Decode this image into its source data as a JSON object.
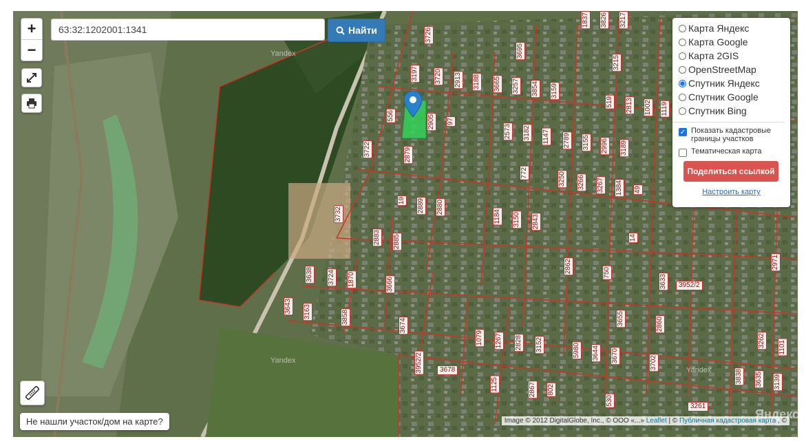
{
  "search": {
    "value": "63:32:1202001:1341",
    "button_label": "Найти"
  },
  "controls": {
    "zoom_in": "+",
    "zoom_out": "−"
  },
  "layers": [
    {
      "label": "Карта Яндекс",
      "selected": false
    },
    {
      "label": "Карта Google",
      "selected": false
    },
    {
      "label": "Карта 2GIS",
      "selected": false
    },
    {
      "label": "OpenStreetMap",
      "selected": false
    },
    {
      "label": "Спутник Яндекс",
      "selected": true
    },
    {
      "label": "Спутник Google",
      "selected": false
    },
    {
      "label": "Спутник Bing",
      "selected": false
    }
  ],
  "options": {
    "cadastral": {
      "label": "Показать кадастровые границы участков",
      "checked": true
    },
    "thematic": {
      "label": "Тематическая карта",
      "checked": false
    }
  },
  "share_label": "Поделиться ссылкой",
  "config_label": "Настроить карту",
  "not_found_label": "Не нашли участок/дом на карте?",
  "attribution": {
    "imagery": "Image © 2012 DigitalGlobe, Inc., © OOO «...»",
    "leaflet": "Leaflet",
    "sep1": "| ©",
    "pkk": "Публичная кадастровая карта",
    "sep2": ", ©"
  },
  "watermarks": [
    "Yandex",
    "Yandex",
    "Yandex",
    "Яндекс"
  ],
  "parcels": [
    "3726",
    "3695",
    "3197",
    "3720",
    "2913",
    "3188",
    "3665",
    "3257",
    "3854",
    "3159",
    "3215",
    "519",
    "2813",
    "1002",
    "1119",
    "556",
    "2905",
    "97",
    "2573",
    "3182",
    "1147",
    "2789",
    "3155",
    "2996",
    "3189",
    "3722",
    "2879",
    "772",
    "3250",
    "3266",
    "3267",
    "1384",
    "49",
    "3732",
    "19",
    "2889",
    "2880",
    "1184",
    "3150",
    "2843",
    "2883",
    "2885",
    "14",
    "2862",
    "750",
    "2971",
    "3633",
    "3952/2",
    "3638",
    "3724",
    "1870",
    "3666",
    "3643",
    "3163",
    "3858",
    "3674",
    "1079",
    "1267",
    "2828",
    "3152",
    "5980",
    "3644",
    "3670",
    "3655",
    "2860",
    "3702",
    "3952/2",
    "3678",
    "1125",
    "2867",
    "802",
    "530",
    "3838",
    "3635",
    "3139",
    "3262",
    "1101",
    "3261",
    "1837",
    "3826",
    "3217"
  ],
  "colors": {
    "parcel_border": "#c0392b",
    "selected_parcel": "#35d25a",
    "marker": "#2a81cb",
    "primary": "#337ab7",
    "danger": "#d9534f"
  }
}
